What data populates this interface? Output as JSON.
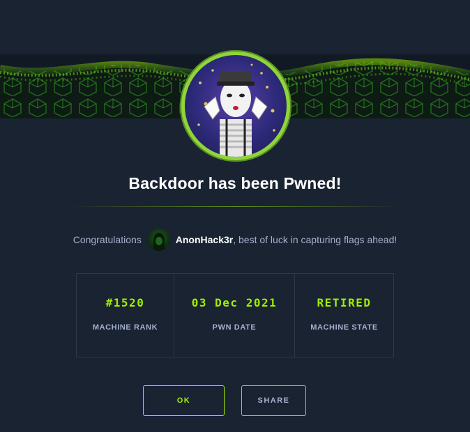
{
  "modal": {
    "title": "Backdoor has been Pwned!",
    "congrats_prefix": "Congratulations",
    "username": "AnonHack3r",
    "congrats_suffix": ", best of luck in capturing flags ahead!"
  },
  "stats": [
    {
      "value": "#1520",
      "label": "MACHINE RANK"
    },
    {
      "value": "03 Dec 2021",
      "label": "PWN DATE"
    },
    {
      "value": "RETIRED",
      "label": "MACHINE STATE"
    }
  ],
  "buttons": {
    "ok_label": "OK",
    "share_label": "SHARE"
  },
  "colors": {
    "background": "#1a2332",
    "accent": "#9fef00",
    "muted": "#a4b1cd",
    "ring": "#8fd43a"
  }
}
